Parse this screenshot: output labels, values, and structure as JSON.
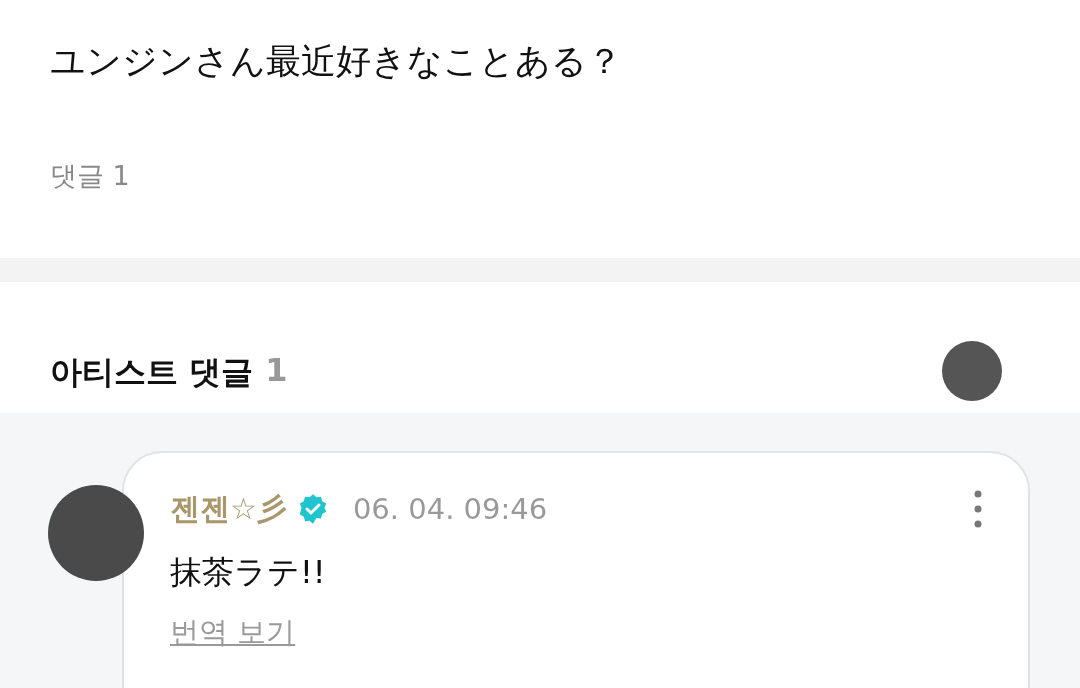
{
  "post": {
    "text": "ユンジンさん最近好きなことある？",
    "comment_count": "댓글 1"
  },
  "artist_comments": {
    "title": "아티스트 댓글",
    "count": "1",
    "comments": [
      {
        "author": "젠젠☆彡",
        "verified": true,
        "time": "06. 04. 09:46",
        "text": "抹茶ラテ!!",
        "translate": "번역 보기"
      }
    ]
  }
}
